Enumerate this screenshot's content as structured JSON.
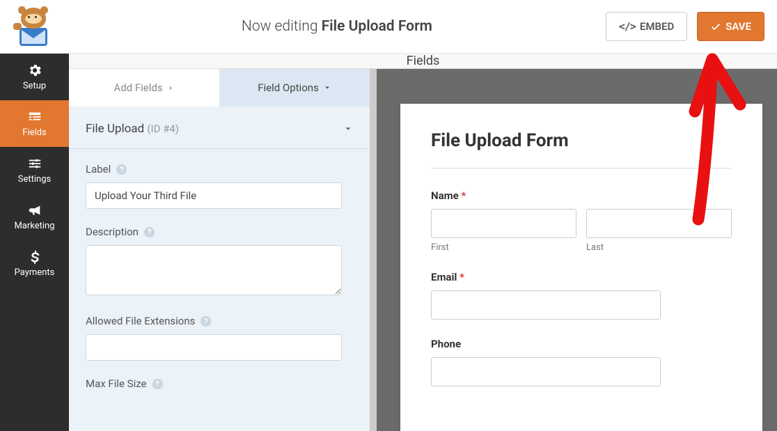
{
  "header": {
    "now_editing_prefix": "Now editing",
    "form_name": "File Upload Form",
    "embed_label": "EMBED",
    "save_label": "SAVE"
  },
  "sidenav": {
    "items": [
      {
        "label": "Setup"
      },
      {
        "label": "Fields"
      },
      {
        "label": "Settings"
      },
      {
        "label": "Marketing"
      },
      {
        "label": "Payments"
      }
    ],
    "active_index": 1
  },
  "builder_bar_title": "Fields",
  "tabs": {
    "add_fields": "Add Fields",
    "field_options": "Field Options"
  },
  "field_panel": {
    "title": "File Upload",
    "id_text": "(ID #4)",
    "label_label": "Label",
    "label_value": "Upload Your Third File",
    "description_label": "Description",
    "description_value": "",
    "allowed_ext_label": "Allowed File Extensions",
    "allowed_ext_value": "",
    "max_size_label": "Max File Size"
  },
  "preview_form": {
    "title": "File Upload Form",
    "name_label": "Name",
    "first_sublabel": "First",
    "last_sublabel": "Last",
    "email_label": "Email",
    "phone_label": "Phone"
  },
  "colors": {
    "accent": "#e27730"
  }
}
